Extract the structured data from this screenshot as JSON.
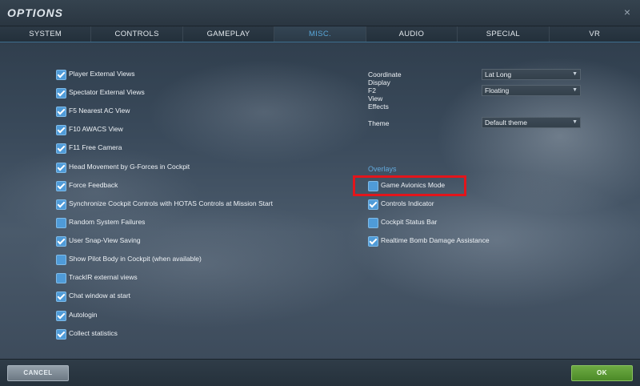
{
  "window": {
    "title": "OPTIONS",
    "close_symbol": "×"
  },
  "tabs": [
    {
      "label": "SYSTEM",
      "active": false
    },
    {
      "label": "CONTROLS",
      "active": false
    },
    {
      "label": "GAMEPLAY",
      "active": false
    },
    {
      "label": "MISC.",
      "active": true
    },
    {
      "label": "AUDIO",
      "active": false
    },
    {
      "label": "SPECIAL",
      "active": false
    },
    {
      "label": "VR",
      "active": false
    }
  ],
  "left_options": [
    {
      "label": "Player External Views",
      "checked": true
    },
    {
      "label": "Spectator External Views",
      "checked": true
    },
    {
      "label": "F5 Nearest AC View",
      "checked": true
    },
    {
      "label": "F10 AWACS View",
      "checked": true
    },
    {
      "label": "F11 Free Camera",
      "checked": true
    },
    {
      "label": "Head Movement by G-Forces in Cockpit",
      "checked": true
    },
    {
      "label": "Force Feedback",
      "checked": true
    },
    {
      "label": "Synchronize Cockpit Controls with HOTAS Controls at Mission Start",
      "checked": true
    },
    {
      "label": "Random System Failures",
      "checked": false
    },
    {
      "label": "User Snap-View Saving",
      "checked": true
    },
    {
      "label": "Show Pilot Body in Cockpit (when available)",
      "checked": false
    },
    {
      "label": "TrackIR external views",
      "checked": false
    },
    {
      "label": "Chat window at start",
      "checked": true
    },
    {
      "label": "Autologin",
      "checked": true
    },
    {
      "label": "Collect statistics",
      "checked": true
    }
  ],
  "settings": {
    "coordinate_display": {
      "label": "Coordinate Display",
      "value": "Lat Long"
    },
    "f2_view_effects": {
      "label": "F2 View Effects",
      "value": "Floating"
    },
    "theme": {
      "label": "Theme",
      "value": "Default theme"
    }
  },
  "overlays": {
    "title": "Overlays",
    "items": [
      {
        "label": "Game Avionics Mode",
        "checked": false
      },
      {
        "label": "Controls Indicator",
        "checked": true
      },
      {
        "label": "Cockpit Status Bar",
        "checked": false
      },
      {
        "label": "Realtime Bomb Damage Assistance",
        "checked": true
      }
    ]
  },
  "footer": {
    "cancel_label": "CANCEL",
    "ok_label": "OK"
  },
  "colors": {
    "accent_blue": "#58a6d8",
    "highlight_red": "#e3151b",
    "ok_green": "#5a9a33"
  }
}
